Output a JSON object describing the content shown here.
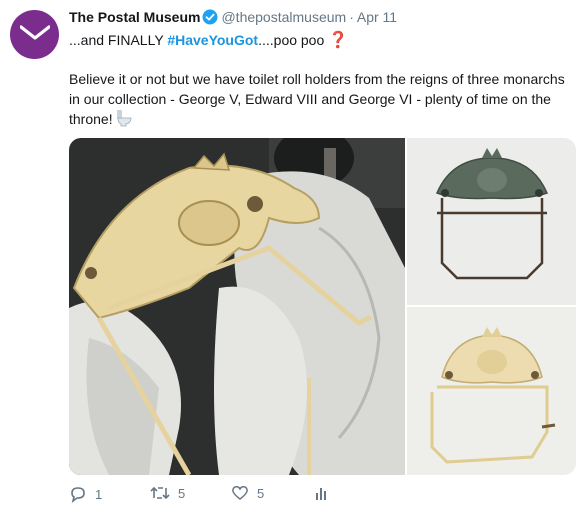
{
  "tweet": {
    "author_name": "The Postal Museum",
    "handle": "@thepostalmuseum",
    "separator": "·",
    "date": "Apr 11",
    "line1_prefix": "...and FINALLY ",
    "hashtag": "#HaveYouGot",
    "line1_suffix": "....poo poo ",
    "line1_emoji": "❓",
    "body": "Believe it or not but we have toilet roll holders from the reigns of three monarchs in our collection - George V, Edward VIII and George VI - plenty of time on the throne!",
    "body_emoji_icon": "toilet-icon"
  },
  "actions": {
    "reply_count": "1",
    "retweet_count": "5",
    "like_count": "5",
    "analytics_icon": "bar-chart-icon"
  },
  "colors": {
    "avatar_bg": "#7b2d8e",
    "verified": "#1da1f2",
    "hashtag": "#1b95e0",
    "muted": "#657786"
  }
}
